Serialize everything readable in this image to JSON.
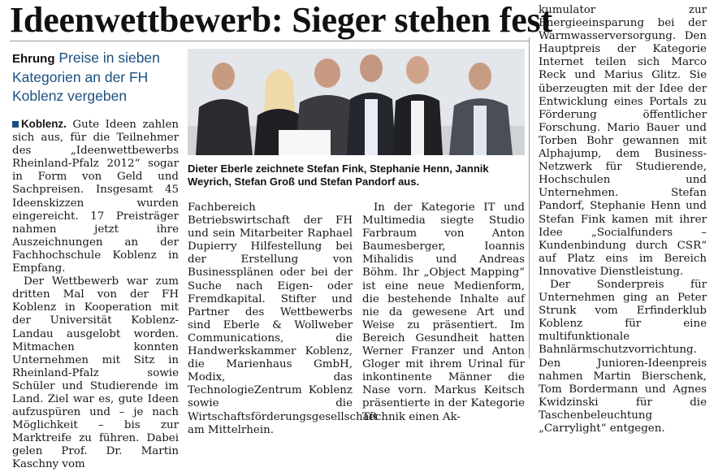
{
  "headline": "Ideenwettbewerb: Sieger stehen fest",
  "kicker": {
    "tag": "Ehrung",
    "text": "Preise in sieben Kategorien an der FH Koblenz vergeben"
  },
  "dateline": "Koblenz.",
  "col1": {
    "p1": "Gute Ideen zahlen sich aus, für die Teilnehmer des „Ideenwettbewerbs Rheinland-Pfalz 2012“ sogar in Form von Geld und Sachpreisen. Insgesamt 45 Ideenskizzen wurden eingereicht. 17 Preisträger nahmen jetzt ihre Auszeichnungen an der Fachhochschule Koblenz in Empfang.",
    "p2": "Der Wettbewerb war zum dritten Mal von der FH Koblenz in Kooperation mit der Universität Koblenz-Landau ausgelobt worden. Mitmachen konnten Unternehmen mit Sitz in Rheinland-Pfalz sowie Schüler und Studierende im Land. Ziel war es, gute Ideen aufzuspüren und – je nach Möglichkeit – bis zur Marktreife zu führen. Dabei gelen Prof. Dr. Martin Kaschny vom"
  },
  "col2": {
    "p1": "Fachbereich Betriebswirtschaft der FH und sein Mitarbeiter Raphael Dupierry Hilfestellung bei der Erstellung von Businessplänen oder bei der Suche nach Eigen- oder Fremdkapital. Stifter und Partner des Wettbewerbs sind Eberle & Wollweber Communications, die Handwerkskammer Koblenz, die Marienhaus GmbH, Modix, das TechnologieZentrum Koblenz sowie die Wirtschaftsförderungsgesellschaft am Mittelrhein."
  },
  "col3": {
    "p1": "In der Kategorie IT und Multimedia siegte Studio Farbraum von Anton Baumesberger, Ioannis Mihalidis und Andreas Böhm. Ihr „Object Mapping“ ist eine neue Medienform, die bestehende Inhalte auf nie da gewesene Art und Weise zu präsentiert. Im Bereich Gesundheit hatten Werner Franzer und Anton Gloger mit ihrem Urinal für inkontinente Männer die Nase vorn. Markus Keitsch präsentierte in der Kategorie Technik einen Ak-"
  },
  "col4": {
    "p1": "kumulator zur Energieeinsparung bei der Warmwasserversorgung. Den Hauptpreis der Kategorie Internet teilen sich Marco Reck und Marius Glitz. Sie überzeugten mit der Idee der Entwicklung eines Portals zu Förderung öffentlicher Forschung. Mario Bauer und Torben Bohr gewannen mit Alphajump, dem Business-Netzwerk für Studierende, Hochschulen und Unternehmen. Stefan Pandorf, Stephanie Henn und Stefan Fink kamen mit ihrer Idee „Socialfunders – Kundenbindung durch CSR“ auf Platz eins im Bereich Innovative Dienstleistung.",
    "p2": "Der Sonderpreis für Unternehmen ging an Peter Strunk vom Erfinderklub Koblenz für eine multifunktionale Bahnlärmschutzvorrichtung. Den Junioren-Ideenpreis nahmen Martin Bierschenk, Tom Bordermann und Agnes Kwidzinski für die Taschenbeleuchtung „Carrylight“ entgegen."
  },
  "photo_caption": "Dieter Eberle zeichnete Stefan Fink, Stephanie Henn, Jannik Weyrich, Stefan Groß und Stefan Pandorf aus.",
  "colors": {
    "accent": "#1a4f80",
    "text": "#161616",
    "rule": "#999999"
  }
}
